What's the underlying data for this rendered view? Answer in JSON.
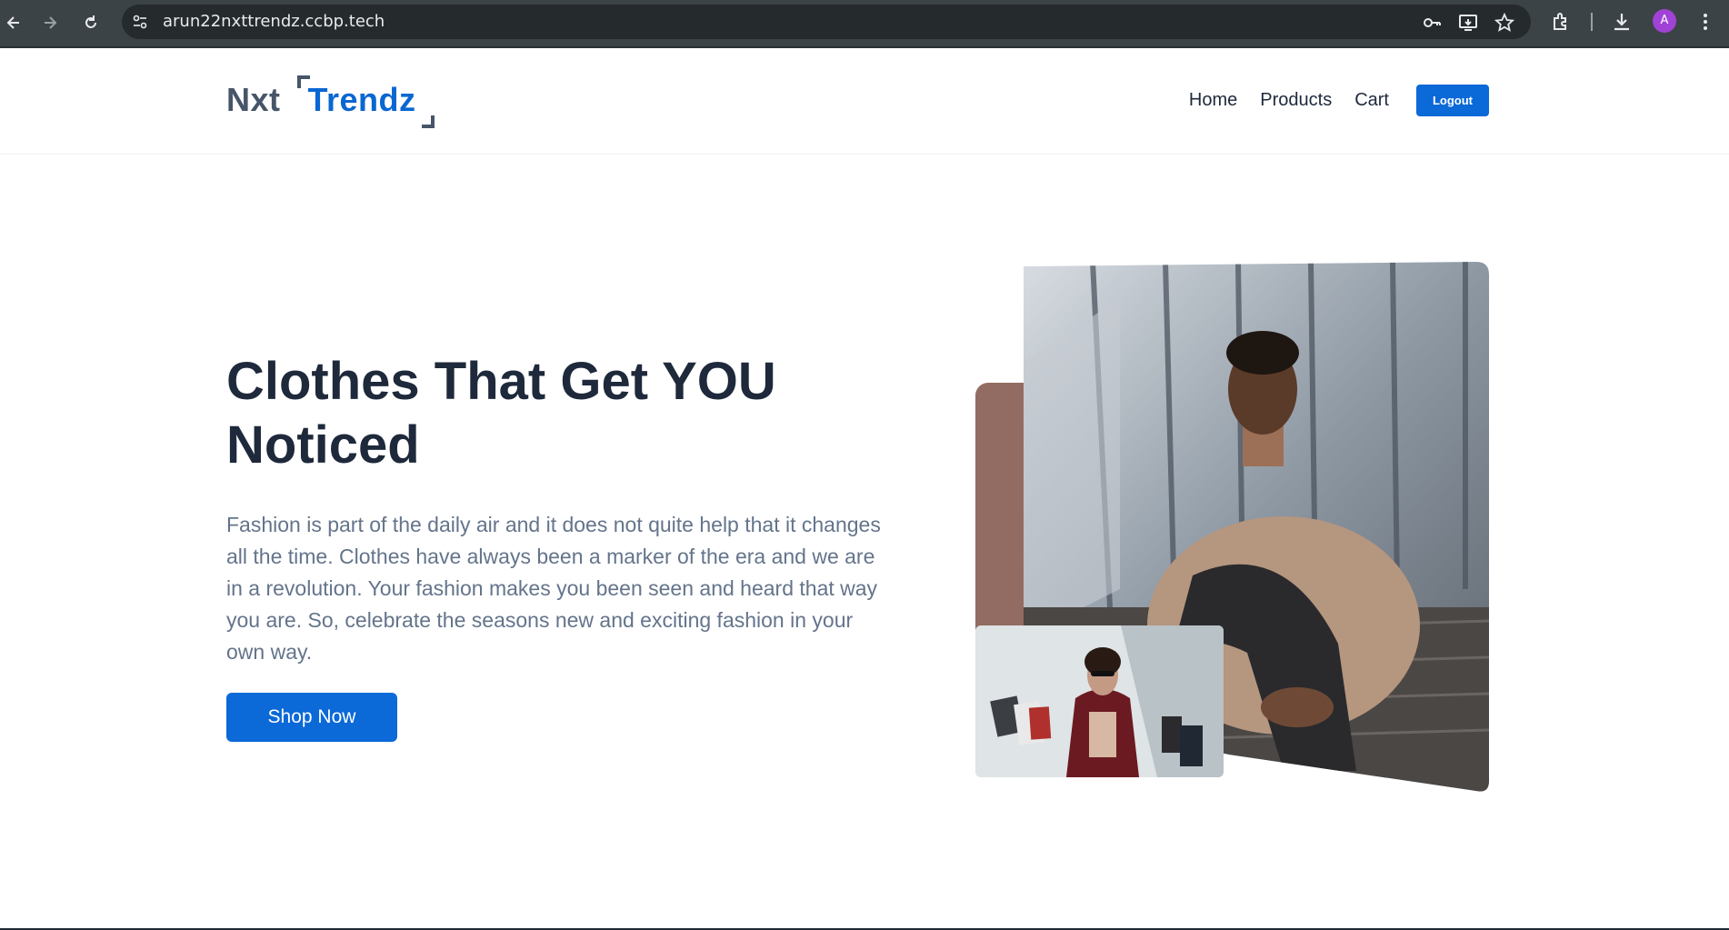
{
  "browser": {
    "url": "arun22nxttrendz.ccbp.tech",
    "profile_initial": "A",
    "icons": [
      "back-icon",
      "forward-icon",
      "reload-icon",
      "site-settings-icon",
      "password-key-icon",
      "install-app-icon",
      "bookmark-star-icon",
      "extensions-icon",
      "download-icon",
      "profile-avatar",
      "more-menu-icon"
    ]
  },
  "header": {
    "logo_part1": "Nxt",
    "logo_part2": "Trendz",
    "nav": [
      "Home",
      "Products",
      "Cart"
    ],
    "logout_label": "Logout"
  },
  "hero": {
    "heading": "Clothes That Get YOU Noticed",
    "description": "Fashion is part of the daily air and it does not quite help that it changes all the time. Clothes have always been a marker of the era and we are in a revolution. Your fashion makes you been seen and heard that way you are. So, celebrate the seasons new and exciting fashion in your own way.",
    "cta_label": "Shop Now"
  },
  "colors": {
    "primary": "#0b69d8",
    "heading": "#1e293b",
    "body": "#64748b",
    "accent_brown": "#926c62"
  }
}
